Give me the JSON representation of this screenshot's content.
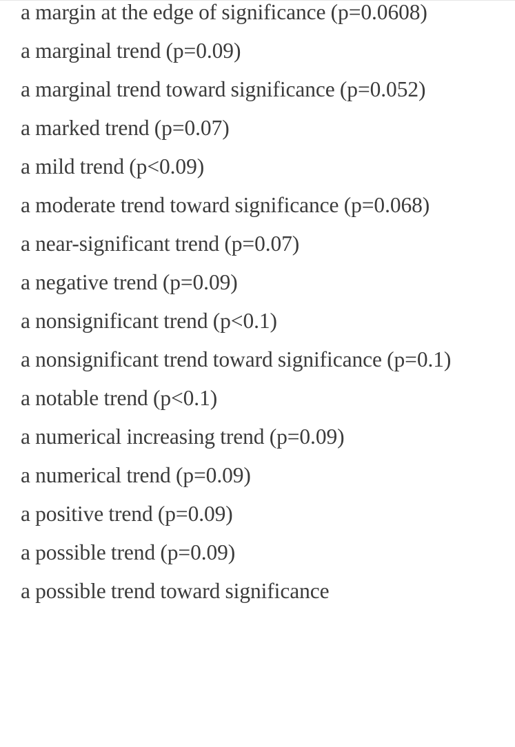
{
  "document": {
    "type": "alphabetical-phrase-list",
    "topic": "euphemisms for marginally non-significant p-values",
    "text_color": "#3b3b3b",
    "background_color": "#ffffff",
    "first_line_clipped_top": true,
    "last_line_clipped_bottom": true,
    "entries": [
      "a margin at the edge of significance (p=0.0608)",
      "a marginal trend (p=0.09)",
      "a marginal trend toward significance (p=0.052)",
      "a marked trend (p=0.07)",
      "a mild trend (p<0.09)",
      "a moderate trend toward significance (p=0.068)",
      "a near-significant trend (p=0.07)",
      "a negative trend (p=0.09)",
      "a nonsignificant trend (p<0.1)",
      "a nonsignificant trend toward significance (p=0.1)",
      "a notable trend (p<0.1)",
      "a numerical increasing trend (p=0.09)",
      "a numerical trend (p=0.09)",
      "a positive trend (p=0.09)",
      "a possible trend (p=0.09)",
      "a possible trend toward significance"
    ]
  }
}
